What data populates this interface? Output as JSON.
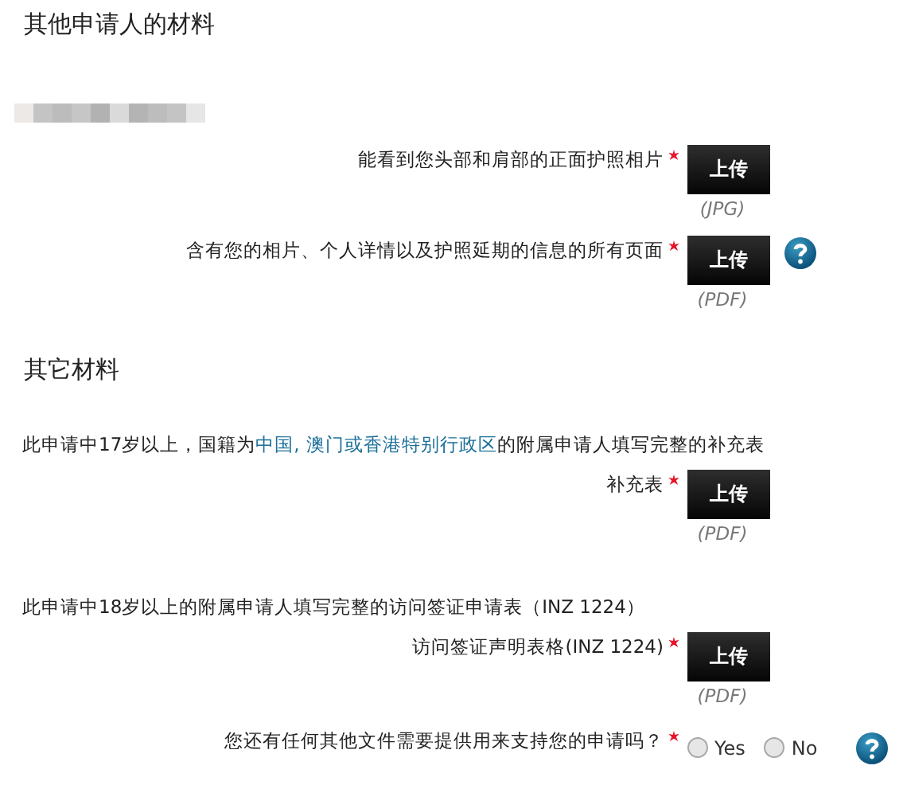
{
  "sections": [
    {
      "title": "其他申请人的材料",
      "applicant_name": {
        "kind": "blurred"
      },
      "items": [
        {
          "kind": "upload",
          "label": "能看到您头部和肩部的正面护照相片",
          "required": true,
          "button": "上传",
          "format": "(JPG)",
          "help": false
        },
        {
          "kind": "upload",
          "label": "含有您的相片、个人详情以及护照延期的信息的所有页面",
          "required": true,
          "button": "上传",
          "format": "(PDF)",
          "help": true
        }
      ]
    },
    {
      "title": "其它材料",
      "items": [
        {
          "kind": "note",
          "segments": [
            {
              "text": "此申请中17岁以上，国籍为",
              "kind": "text"
            },
            {
              "text": "中国,",
              "kind": "link"
            },
            {
              "text": "澳门或香港特别行政区",
              "kind": "link"
            },
            {
              "text": "的附属申请人填写完整的补充表",
              "kind": "text"
            }
          ]
        },
        {
          "kind": "upload",
          "label": "补充表",
          "required": true,
          "button": "上传",
          "format": "(PDF)",
          "help": false
        },
        {
          "kind": "note",
          "segments": [
            {
              "text": "此申请中18岁以上的附属申请人填写完整的访问签证申请表（INZ 1224）",
              "kind": "text"
            }
          ]
        },
        {
          "kind": "upload",
          "label": "访问签证声明表格(INZ 1224)",
          "required": true,
          "button": "上传",
          "format": "(PDF)",
          "help": false
        },
        {
          "kind": "radio",
          "label": "您还有任何其他文件需要提供用来支持您的申请吗？",
          "required": true,
          "options": [
            {
              "label": "Yes",
              "selected": false
            },
            {
              "label": "No",
              "selected": false
            }
          ],
          "help": true
        }
      ]
    }
  ]
}
